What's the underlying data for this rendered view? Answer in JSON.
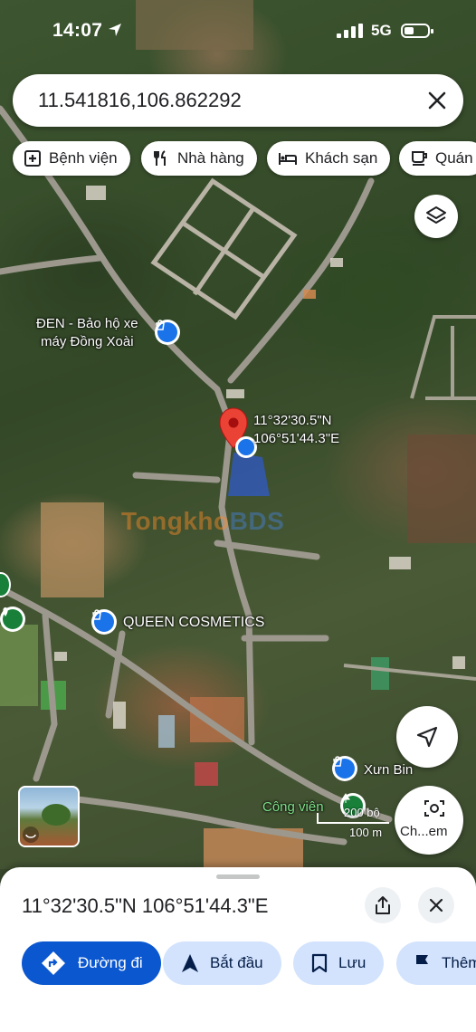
{
  "status_bar": {
    "time": "14:07",
    "network": "5G"
  },
  "search": {
    "value": "11.541816,106.862292"
  },
  "chips": [
    {
      "label": "Bệnh viện",
      "icon": "hospital-icon"
    },
    {
      "label": "Nhà hàng",
      "icon": "restaurant-icon"
    },
    {
      "label": "Khách sạn",
      "icon": "hotel-icon"
    },
    {
      "label": "Quán",
      "icon": "cafe-icon"
    }
  ],
  "map": {
    "pin_coords": {
      "lat": "11°32'30.5\"N",
      "lng": "106°51'44.3\"E"
    },
    "poi_labels": {
      "den_line1": "ĐEN - Bảo hộ xe",
      "den_line2": "máy Đồng Xoài",
      "queen": "QUEEN COSMETICS",
      "xun": "Xưn Bin",
      "park": "Công viên"
    },
    "watermark": {
      "part1": "Tongkho",
      "part2": "BDS"
    },
    "scale": {
      "top": "200 bộ",
      "bottom": "100 m"
    },
    "explore_label": "Ch...em",
    "colors": {
      "pin": "#ea4335",
      "location_dot": "#1a73e8",
      "poi": "#1a73e8",
      "park": "#188038"
    }
  },
  "sheet": {
    "coordinates": "11°32'30.5\"N 106°51'44.3\"E",
    "actions": [
      {
        "label": "Đường đi",
        "icon": "directions-icon"
      },
      {
        "label": "Bắt đầu",
        "icon": "navigation-icon"
      },
      {
        "label": "Lưu",
        "icon": "bookmark-icon"
      },
      {
        "label": "Thêm",
        "icon": "flag-icon"
      }
    ]
  }
}
